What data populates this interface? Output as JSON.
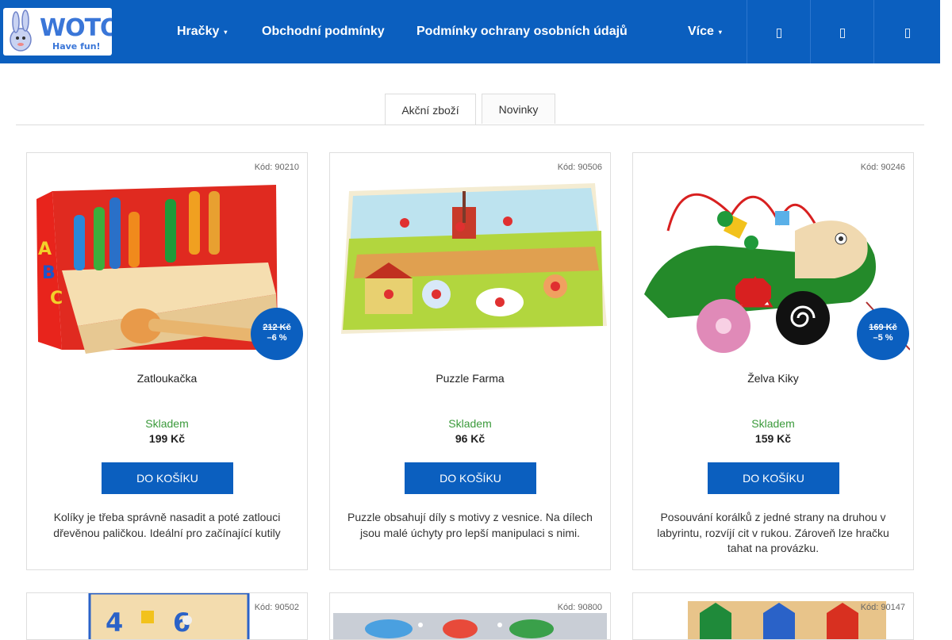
{
  "header": {
    "logo_text": "WOTO",
    "logo_tagline": "Have fun!",
    "nav": [
      {
        "label": "Hračky",
        "caret": "▾"
      },
      {
        "label": "Obchodní podmínky"
      },
      {
        "label": "Podmínky ochrany osobních údajů"
      },
      {
        "label": "Více",
        "caret": "▾"
      }
    ],
    "icons": [
      "search-icon",
      "user-icon",
      "cart-icon"
    ]
  },
  "tabs": [
    {
      "label": "Akční zboží",
      "active": true
    },
    {
      "label": "Novinky",
      "active": false
    }
  ],
  "colors": {
    "brand": "#0b5fbf",
    "stock": "#3b9a3b"
  },
  "products": [
    {
      "code": "Kód: 90210",
      "name": "Zatloukačka",
      "stock": "Skladem",
      "price": "199 Kč",
      "old_price": "212 Kč",
      "discount": "–6 %",
      "button": "DO KOŠÍKU",
      "description": "Kolíky je třeba správně nasadit a poté zatlouci dřevěnou paličkou. Ideální pro začínající kutily"
    },
    {
      "code": "Kód: 90506",
      "name": "Puzzle Farma",
      "stock": "Skladem",
      "price": "96 Kč",
      "button": "DO KOŠÍKU",
      "description": "Puzzle obsahují díly s motivy z vesnice. Na dílech jsou malé úchyty pro lepší manipulaci s nimi."
    },
    {
      "code": "Kód: 90246",
      "name": "Želva Kiky",
      "stock": "Skladem",
      "price": "159 Kč",
      "old_price": "169 Kč",
      "discount": "–5 %",
      "button": "DO KOŠÍKU",
      "description": "Posouvání korálků z jedné strany na druhou v labyrintu, rozvíjí cit v rukou. Zároveň lze hračku tahat na provázku."
    }
  ],
  "products_row2": [
    {
      "code": "Kód: 90502"
    },
    {
      "code": "Kód: 90800"
    },
    {
      "code": "Kód: 90147"
    }
  ]
}
